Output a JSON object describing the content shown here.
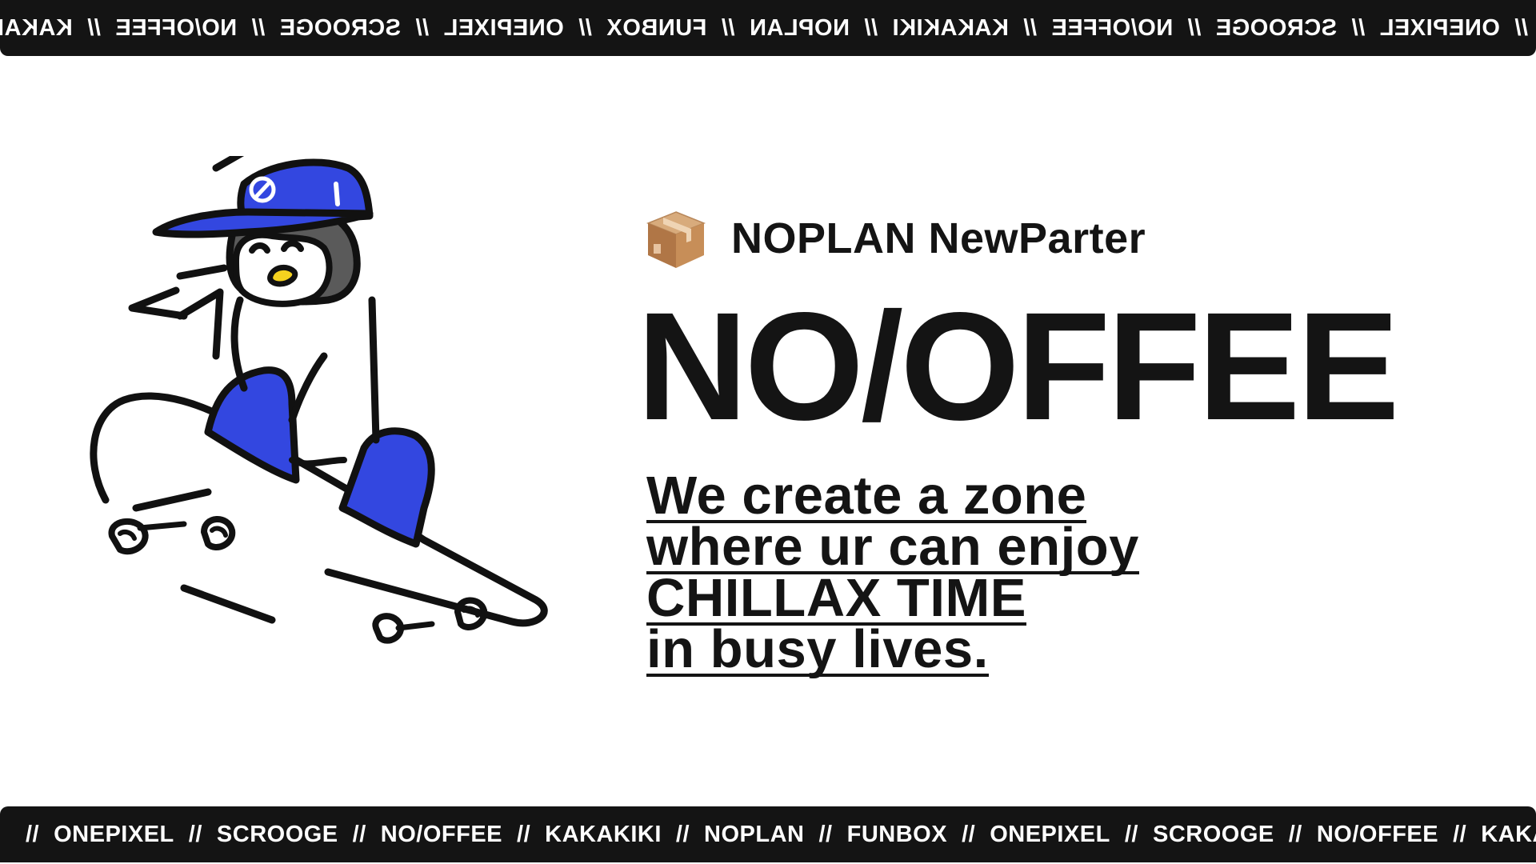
{
  "marquee_top": {
    "items": [
      "ONEPIXEL",
      "SCROOGE",
      "NO/OFFEE",
      "KAKAKIKI",
      "NOPLAN",
      "FUNBOX",
      "ONEPIXEL",
      "SCROOGE",
      "NO/OFFEE",
      "KAKAKIKI"
    ],
    "separator": "//"
  },
  "marquee_bottom": {
    "items": [
      "ONEPIXEL",
      "SCROOGE",
      "NO/OFFEE",
      "KAKAKIKI",
      "NOPLAN",
      "FUNBOX",
      "ONEPIXEL",
      "SCROOGE",
      "NO/OFFEE",
      "KAKAKIKI"
    ],
    "separator": "//"
  },
  "mascot": {
    "icon": "penguin-skateboarder-icon",
    "accent_color": "#3347e0"
  },
  "brand": {
    "icon": "package-box-icon",
    "name": "NOPLAN NewParter"
  },
  "headline": "NO/OFFEE",
  "tagline": {
    "lines": [
      "We create a zone",
      "where ur can enjoy",
      "CHILLAX TIME",
      "in busy lives."
    ]
  },
  "colors": {
    "ink": "#141414",
    "background": "#ffffff",
    "accent": "#3347e0"
  }
}
